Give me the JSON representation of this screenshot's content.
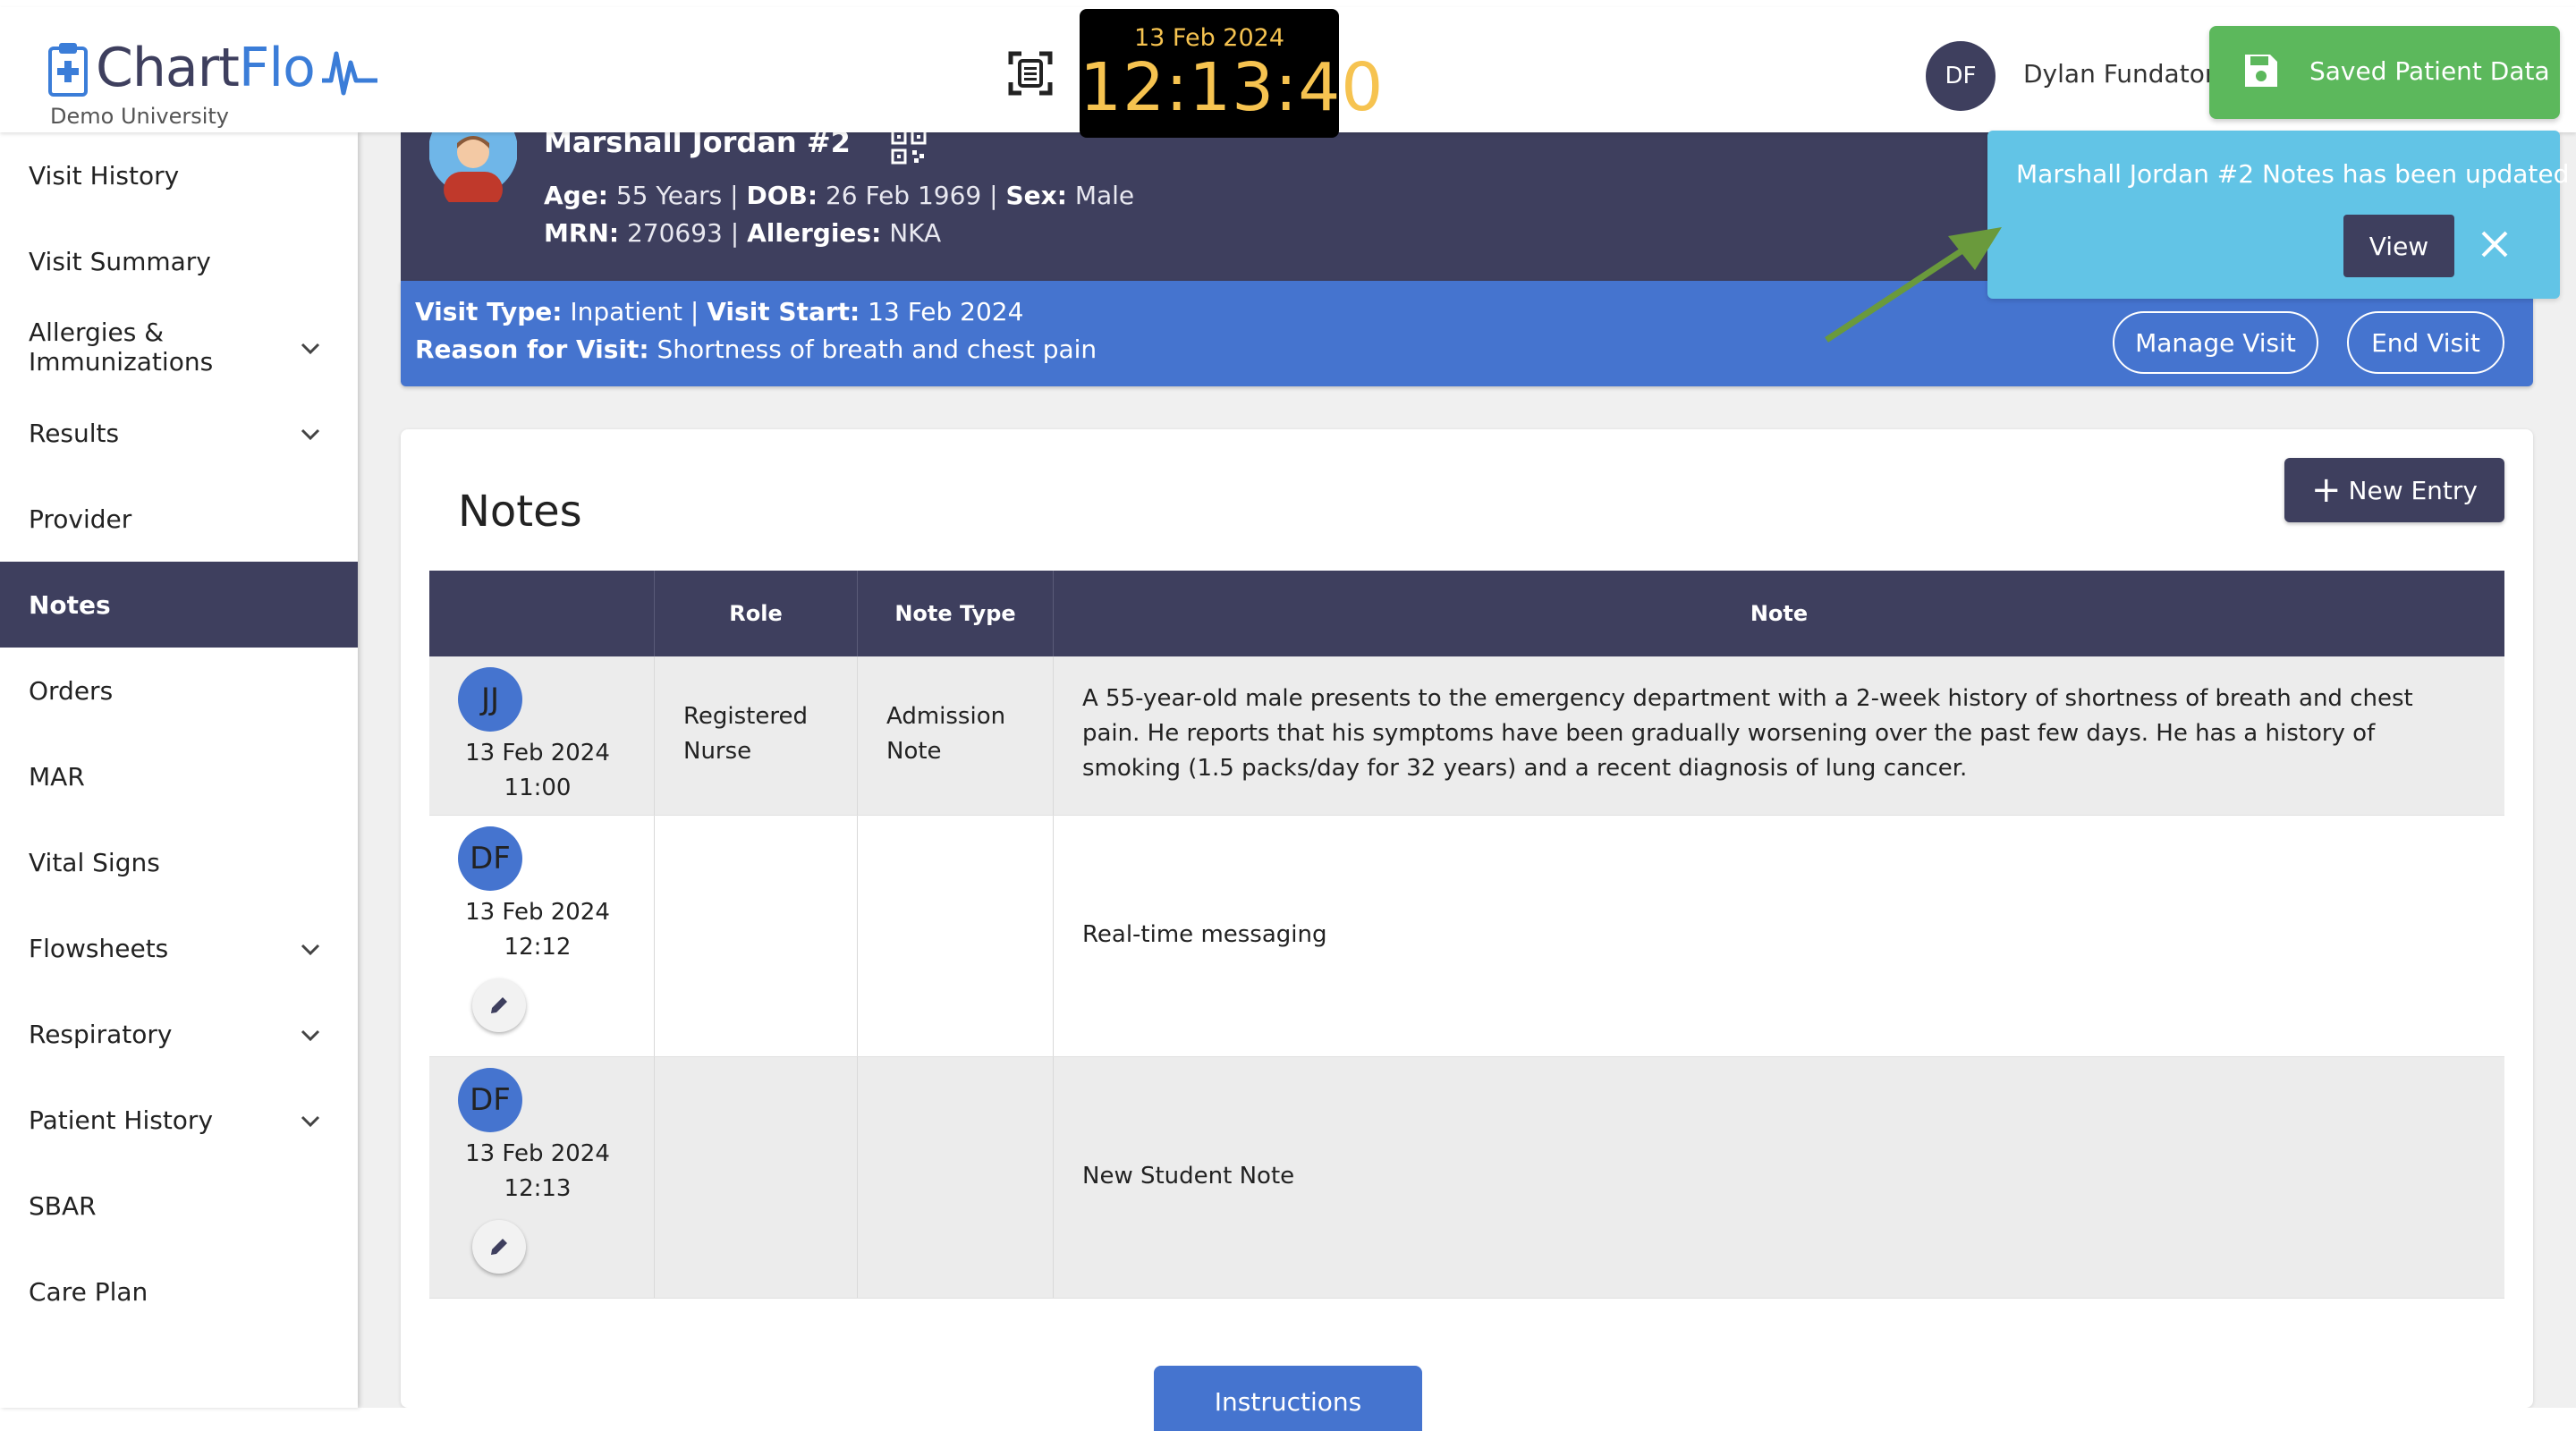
{
  "app": {
    "logo_word_part1": "Chart",
    "logo_word_part2": "Flo",
    "logo_subtitle": "Demo University"
  },
  "clock": {
    "date": "13 Feb 2024",
    "time": "12:13:40"
  },
  "user": {
    "initials": "DF",
    "name": "Dylan Fundator"
  },
  "save_button": {
    "label": "Saved Patient Data"
  },
  "sidebar": {
    "items": [
      {
        "label": "Visit History",
        "expandable": false,
        "active": false
      },
      {
        "label": "Visit Summary",
        "expandable": false,
        "active": false
      },
      {
        "label": "Allergies & Immunizations",
        "expandable": true,
        "active": false
      },
      {
        "label": "Results",
        "expandable": true,
        "active": false
      },
      {
        "label": "Provider",
        "expandable": false,
        "active": false
      },
      {
        "label": "Notes",
        "expandable": false,
        "active": true
      },
      {
        "label": "Orders",
        "expandable": false,
        "active": false
      },
      {
        "label": "MAR",
        "expandable": false,
        "active": false
      },
      {
        "label": "Vital Signs",
        "expandable": false,
        "active": false
      },
      {
        "label": "Flowsheets",
        "expandable": true,
        "active": false
      },
      {
        "label": "Respiratory",
        "expandable": true,
        "active": false
      },
      {
        "label": "Patient History",
        "expandable": true,
        "active": false
      },
      {
        "label": "SBAR",
        "expandable": false,
        "active": false
      },
      {
        "label": "Care Plan",
        "expandable": false,
        "active": false
      }
    ]
  },
  "patient": {
    "name": "Marshall Jordan #2",
    "age_label": "Age:",
    "age": "55 Years",
    "dob_label": "DOB:",
    "dob": "26 Feb 1969",
    "sex_label": "Sex:",
    "sex": "Male",
    "mrn_label": "MRN:",
    "mrn": "270693",
    "allergies_label": "Allergies:",
    "allergies": "NKA",
    "sep": "|"
  },
  "visit": {
    "type_label": "Visit Type:",
    "type": "Inpatient",
    "start_label": "Visit Start:",
    "start": "13 Feb 2024",
    "reason_label": "Reason for Visit:",
    "reason": "Shortness of breath and chest pain",
    "manage_label": "Manage Visit",
    "end_label": "End Visit"
  },
  "notes": {
    "title": "Notes",
    "new_entry_label": "New Entry",
    "columns": [
      "",
      "Role",
      "Note Type",
      "Note"
    ],
    "rows": [
      {
        "initials": "JJ",
        "date": "13 Feb 2024",
        "time": "11:00",
        "role_line1": "Registered",
        "role_line2": "Nurse",
        "type_line1": "Admission",
        "type_line2": "Note",
        "note": "A 55-year-old male presents to the emergency department with a 2-week history of shortness of breath and chest pain. He reports that his symptoms have been gradually worsening over the past few days. He has a history of smoking (1.5 packs/day for 32 years) and a recent diagnosis of lung cancer.",
        "editable": false
      },
      {
        "initials": "DF",
        "date": "13 Feb 2024",
        "time": "12:12",
        "note": "Real-time messaging",
        "editable": true
      },
      {
        "initials": "DF",
        "date": "13 Feb 2024",
        "time": "12:13",
        "note": "New Student Note",
        "editable": true
      }
    ]
  },
  "toast": {
    "message": "Marshall Jordan #2 Notes has been updated",
    "view_label": "View"
  },
  "instructions_label": "Instructions",
  "colors": {
    "navy": "#3e3f5e",
    "blue": "#4574cf",
    "green": "#5cb85c",
    "toast": "#62c4e6",
    "clock_text": "#f6c350",
    "arrow": "#6a9a3c"
  }
}
